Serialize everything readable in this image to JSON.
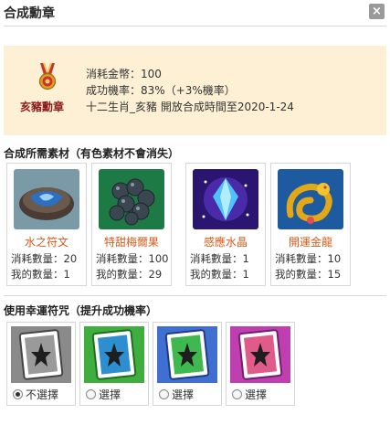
{
  "window": {
    "title": "合成勳章",
    "close_label": "×"
  },
  "medal": {
    "name": "亥豬勳章",
    "icon": "medal-icon",
    "cost": "消耗金幣：100",
    "success_rate": "成功機率：83%（+3%機率）",
    "availability": "十二生肖_亥豬 開放合成時間至2020-1-24"
  },
  "materials": {
    "title": "合成所需素材（有色素材不會消失）",
    "items": [
      {
        "name": "水之符文",
        "consume": "消耗數量：20",
        "owned": "我的數量：1",
        "icon": "water-rune-icon"
      },
      {
        "name": "特甜梅爾果",
        "consume": "消耗數量：100",
        "owned": "我的數量：29",
        "icon": "berry-icon"
      },
      {
        "name": "感應水晶",
        "consume": "消耗數量：1",
        "owned": "我的數量：1",
        "icon": "crystal-icon"
      },
      {
        "name": "開運金龍",
        "consume": "消耗數量：10",
        "owned": "我的數量：15",
        "icon": "golden-dragon-icon"
      }
    ],
    "name_color": "#d45a1a"
  },
  "charms": {
    "title": "使用幸運符咒（提升成功機率）",
    "items": [
      {
        "label": "不選擇",
        "selected": true,
        "color": "#9a9a9a"
      },
      {
        "label": "選擇",
        "selected": false,
        "color": "#3fae3f"
      },
      {
        "label": "選擇",
        "selected": false,
        "color": "#3f6fd0"
      },
      {
        "label": "選擇",
        "selected": false,
        "color": "#c03fb0"
      }
    ]
  }
}
